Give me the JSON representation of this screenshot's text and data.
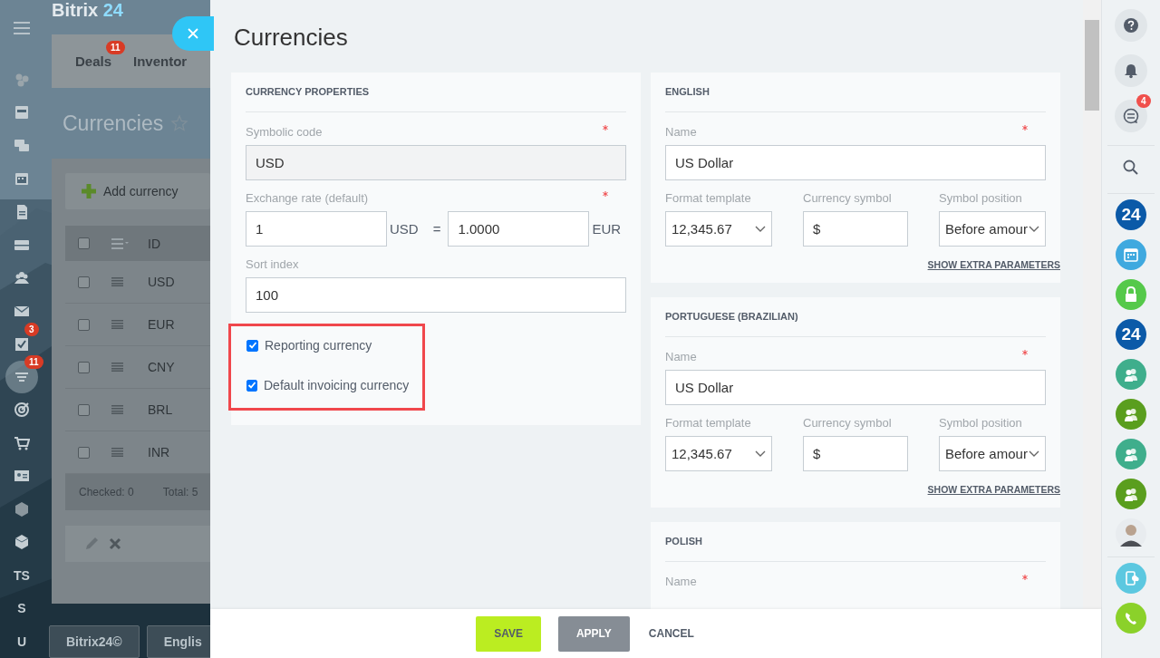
{
  "background_page": {
    "logo": {
      "text": "Bitrix",
      "accent": "24"
    },
    "nav": [
      {
        "kind": "icon",
        "selected": false
      },
      {
        "kind": "icon",
        "selected": false
      },
      {
        "kind": "icon",
        "selected": false
      },
      {
        "kind": "icon",
        "selected": false
      },
      {
        "kind": "icon",
        "selected": false
      },
      {
        "kind": "icon",
        "selected": false
      },
      {
        "kind": "icon",
        "selected": false
      },
      {
        "kind": "icon",
        "selected": false
      },
      {
        "kind": "icon",
        "selected": false,
        "badge": "3"
      },
      {
        "kind": "icon",
        "selected": true,
        "badge": "11"
      },
      {
        "kind": "icon",
        "selected": false
      },
      {
        "kind": "icon",
        "selected": false
      },
      {
        "kind": "icon",
        "selected": false
      },
      {
        "kind": "icon",
        "selected": false
      },
      {
        "kind": "icon",
        "selected": false
      },
      {
        "kind": "text",
        "label": "TS",
        "selected": false
      },
      {
        "kind": "text",
        "label": "S",
        "selected": false
      },
      {
        "kind": "text",
        "label": "U",
        "selected": false
      }
    ],
    "tabs": [
      {
        "label": "Deals",
        "badge": "11"
      },
      {
        "label": "Inventor"
      }
    ],
    "title": "Currencies",
    "add_button": "Add currency",
    "table": {
      "columns": [
        "ID"
      ],
      "all_checked": false,
      "rows": [
        {
          "cells": [
            "USD"
          ],
          "checked": false
        },
        {
          "cells": [
            "EUR"
          ],
          "checked": false
        },
        {
          "cells": [
            "CNY"
          ],
          "checked": false
        },
        {
          "cells": [
            "BRL"
          ],
          "checked": false
        },
        {
          "cells": [
            "INR"
          ],
          "checked": false
        }
      ]
    },
    "footer": [
      "Checked: 0",
      "Total: 5"
    ],
    "bottom_buttons": [
      "Bitrix24©",
      "Englis"
    ]
  },
  "slider": {
    "title": "Currencies",
    "properties": {
      "heading": "CURRENCY PROPERTIES",
      "symbolic_code": {
        "label": "Symbolic code",
        "value": "USD",
        "required": true,
        "disabled": true
      },
      "exchange_rate": {
        "label": "Exchange rate (default)",
        "required": true,
        "amount": "1",
        "from": "USD",
        "sign": "=",
        "rate": "1.0000",
        "to": "EUR"
      },
      "sort_index": {
        "label": "Sort index",
        "value": "100"
      },
      "highlighted": true,
      "checkboxes": [
        {
          "label": "Reporting currency",
          "checked": true
        },
        {
          "label": "Default invoicing currency",
          "checked": true
        }
      ]
    },
    "languages": [
      {
        "heading": "ENGLISH",
        "name": {
          "label": "Name",
          "value": "US Dollar",
          "required": true
        },
        "format": {
          "label": "Format template",
          "value": "12,345.67"
        },
        "symbol": {
          "label": "Currency symbol",
          "value": "$"
        },
        "position": {
          "label": "Symbol position",
          "value": "Before amour"
        },
        "link": "SHOW EXTRA PARAMETERS"
      },
      {
        "heading": "PORTUGUESE (BRAZILIAN)",
        "name": {
          "label": "Name",
          "value": "US Dollar",
          "required": true
        },
        "format": {
          "label": "Format template",
          "value": "12,345.67"
        },
        "symbol": {
          "label": "Currency symbol",
          "value": "$"
        },
        "position": {
          "label": "Symbol position",
          "value": "Before amour"
        },
        "link": "SHOW EXTRA PARAMETERS"
      },
      {
        "heading": "POLISH",
        "name": {
          "label": "Name",
          "required": true
        }
      }
    ],
    "buttons": [
      {
        "label": "SAVE",
        "kind": "primary"
      },
      {
        "label": "APPLY",
        "kind": "secondary"
      },
      {
        "label": "CANCEL",
        "kind": "link"
      }
    ]
  },
  "right_bar": {
    "items": [
      {
        "kind": "help"
      },
      {
        "kind": "bell"
      },
      {
        "kind": "chat",
        "badge": "4"
      },
      {
        "kind": "search"
      },
      {
        "kind": "logo",
        "label": "24",
        "color": "#0b5aa8"
      },
      {
        "kind": "calendar",
        "color": "#3fa9df"
      },
      {
        "kind": "lock",
        "color": "#55c94a"
      },
      {
        "kind": "logo",
        "label": "24",
        "color": "#0b5aa8"
      },
      {
        "kind": "group",
        "color": "#3fae8c"
      },
      {
        "kind": "group",
        "color": "#5a9e1e"
      },
      {
        "kind": "group",
        "color": "#3fae8c"
      },
      {
        "kind": "group",
        "color": "#5a9e1e"
      },
      {
        "kind": "avatar"
      },
      {
        "kind": "mobile",
        "color": "#5cc8e0"
      },
      {
        "kind": "call",
        "color": "#8bd12a"
      }
    ]
  }
}
